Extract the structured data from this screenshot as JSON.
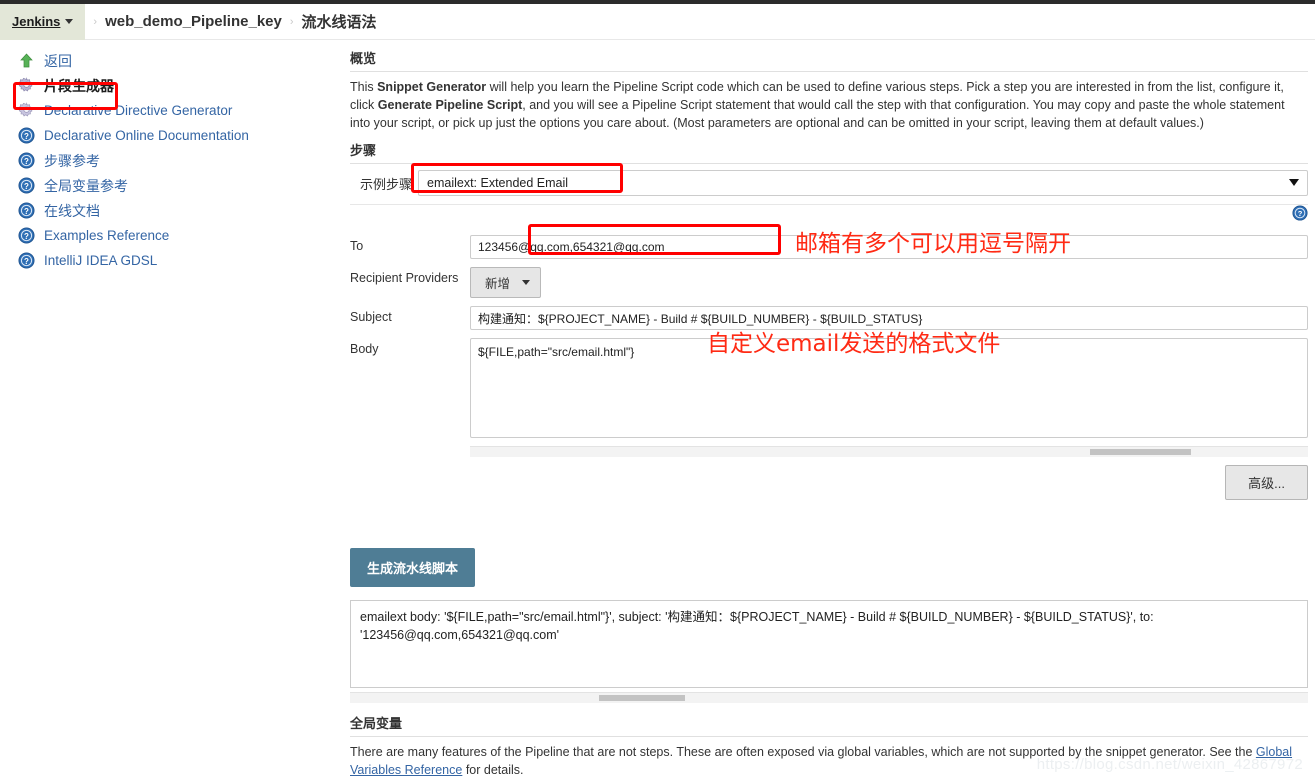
{
  "breadcrumb": {
    "root": "Jenkins",
    "job": "web_demo_Pipeline_key",
    "page": "流水线语法",
    "sep": "›"
  },
  "sidebar": {
    "items": [
      {
        "label": "返回",
        "icon": "up-arrow-icon"
      },
      {
        "label": "片段生成器",
        "icon": "gear-icon"
      },
      {
        "label": "Declarative Directive Generator",
        "icon": "gear-icon"
      },
      {
        "label": "Declarative Online Documentation",
        "icon": "help-icon"
      },
      {
        "label": "步骤参考",
        "icon": "help-icon"
      },
      {
        "label": "全局变量参考",
        "icon": "help-icon"
      },
      {
        "label": "在线文档",
        "icon": "help-icon"
      },
      {
        "label": "Examples Reference",
        "icon": "help-icon"
      },
      {
        "label": "IntelliJ IDEA GDSL",
        "icon": "help-icon"
      }
    ]
  },
  "overview": {
    "title": "概览",
    "p1_a": "This ",
    "p1_b1": "Snippet Generator",
    "p1_c": " will help you learn the Pipeline Script code which can be used to define various steps. Pick a step you are interested in from the list, configure it, click ",
    "p1_b2": "Generate Pipeline Script",
    "p1_d": ", and you will see a Pipeline Script statement that would call the step with that configuration. You may copy and paste the whole statement into your script, or pick up just the options you care about. (Most parameters are optional and can be omitted in your script, leaving them at default values.)"
  },
  "steps": {
    "title": "步骤",
    "sample_step_label": "示例步骤",
    "selected_step": "emailext: Extended Email"
  },
  "form": {
    "to": {
      "label": "To",
      "value": "123456@qq.com,654321@qq.com"
    },
    "recipient_providers": {
      "label": "Recipient Providers",
      "button": "新增"
    },
    "subject": {
      "label": "Subject",
      "value": "构建通知：${PROJECT_NAME} - Build # ${BUILD_NUMBER} - ${BUILD_STATUS}"
    },
    "body": {
      "label": "Body",
      "value": "${FILE,path=\"src/email.html\"}"
    },
    "advanced_button": "高级..."
  },
  "annotations": {
    "email_note": "邮箱有多个可以用逗号隔开",
    "body_note": "自定义email发送的格式文件"
  },
  "generate": {
    "button": "生成流水线脚本",
    "script": "emailext body: '${FILE,path=\"src/email.html\"}', subject: '构建通知：${PROJECT_NAME} - Build # ${BUILD_NUMBER} - ${BUILD_STATUS}', to: '123456@qq.com,654321@qq.com'"
  },
  "global_vars": {
    "title": "全局变量",
    "text_a": "There are many features of the Pipeline that are not steps. These are often exposed via global variables, which are not supported by the snippet generator. See the ",
    "link": "Global Variables Reference",
    "text_b": " for details."
  },
  "watermark": "https://blog.csdn.net/weixin_42867972",
  "colors": {
    "accent": "#3465a4",
    "generate_button": "#4f7d95",
    "annotation_red": "#ff2a14",
    "breadcrumb_active_bg": "#e3e7d8"
  }
}
